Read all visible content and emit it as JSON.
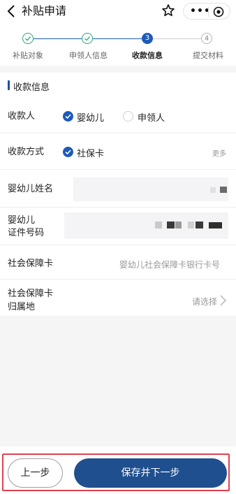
{
  "header": {
    "title": "补贴申请",
    "menu_dots": "•••"
  },
  "steps": [
    {
      "label": "补贴对象",
      "state": "done",
      "badge": ""
    },
    {
      "label": "申领人信息",
      "state": "done",
      "badge": ""
    },
    {
      "label": "收款信息",
      "state": "active",
      "badge": "3"
    },
    {
      "label": "提交材料",
      "state": "todo",
      "badge": "4"
    }
  ],
  "section": {
    "title": "收款信息"
  },
  "form": {
    "payee": {
      "label": "收款人",
      "options": [
        "婴幼儿",
        "申领人"
      ],
      "selected": "婴幼儿"
    },
    "payment_method": {
      "label": "收款方式",
      "option": "社保卡",
      "more": "更多"
    },
    "child_name": {
      "label": "婴幼儿姓名"
    },
    "child_id": {
      "label_line1": "婴幼儿",
      "label_line2": "证件号码"
    },
    "ss_card": {
      "label": "社会保障卡",
      "placeholder": "婴幼儿社会保障卡银行卡号"
    },
    "ss_region": {
      "label_line1": "社会保障卡",
      "label_line2": "归属地",
      "placeholder": "请选择"
    }
  },
  "footer": {
    "prev_label": "上一步",
    "next_label": "保存并下一步"
  },
  "colors": {
    "primary": "#1f4f8e",
    "radio": "#1e5bb8",
    "step_done": "#2aa876",
    "highlight": "#e0414f"
  }
}
